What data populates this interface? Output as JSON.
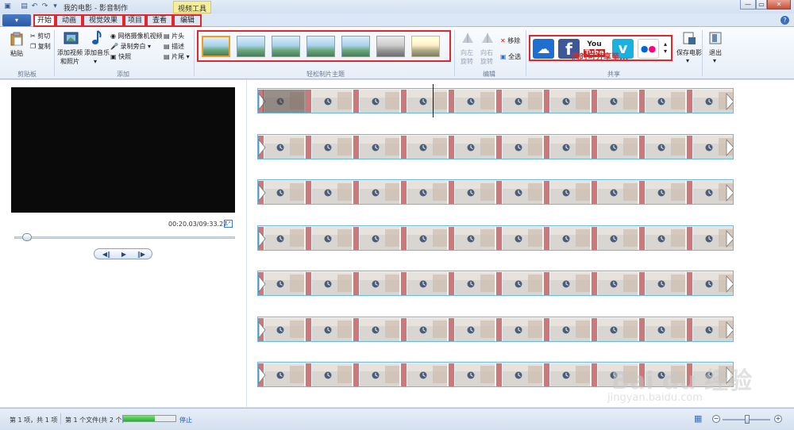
{
  "window": {
    "title": "我的电影 - 影音制作",
    "context_tab": "视频工具",
    "controls": {
      "minimize": "—",
      "maximize": "▭",
      "close": "✕"
    }
  },
  "tabs": [
    {
      "label": "开始",
      "active": true
    },
    {
      "label": "动画",
      "active": false
    },
    {
      "label": "视觉效果",
      "active": false
    },
    {
      "label": "项目",
      "active": false
    },
    {
      "label": "查看",
      "active": false
    },
    {
      "label": "编辑",
      "active": false
    }
  ],
  "file_button": "▾",
  "ribbon": {
    "clipboard": {
      "paste": "粘贴",
      "cut": "剪切",
      "copy": "复制",
      "group": "剪贴板"
    },
    "add": {
      "add_video_line1": "添加视频",
      "add_video_line2": "和照片",
      "add_music": "添加音乐",
      "webcam": "网络摄像机视频",
      "narration": "录制旁白",
      "snapshot": "快照",
      "title": "片头",
      "caption": "描述",
      "credits": "片尾",
      "group": "添加"
    },
    "themes": {
      "group": "轻松制片主题",
      "count": 7,
      "selected_index": 0
    },
    "editing": {
      "rotate_left_line1": "向左",
      "rotate_left_line2": "旋转",
      "rotate_right_line1": "向右",
      "rotate_right_line2": "旋转",
      "remove": "移除",
      "select_all": "全选",
      "group": "编辑"
    },
    "share": {
      "group": "共享",
      "note": "同时可分享至...",
      "services": [
        {
          "name": "onedrive",
          "glyph": "☁",
          "color": "#1e6fd0"
        },
        {
          "name": "facebook",
          "glyph": "f",
          "color": "#3b5998"
        },
        {
          "name": "youtube",
          "glyph": "You\nTube",
          "color": "#d62020"
        },
        {
          "name": "vimeo",
          "glyph": "v",
          "color": "#1ab0e0"
        },
        {
          "name": "flickr",
          "glyph": "●●",
          "color": "#ffffff"
        }
      ],
      "save_movie": "保存电影"
    },
    "exit": {
      "label": "退出"
    }
  },
  "preview": {
    "time": "00:20.03/09:33.27",
    "seek_fraction": 0.035
  },
  "storyboard": {
    "rows": 7,
    "frames_per_row": 10
  },
  "status": {
    "items": "第 1 项，共 1 项",
    "files": "第 1 个文件(共 2 个)",
    "progress_fraction": 0.6,
    "stop": "停止"
  },
  "watermark": {
    "logo": "Bai du 经验",
    "url": "jingyan.baidu.com"
  },
  "colors": {
    "highlight": "#e0282c",
    "accent": "#3a6fc0"
  }
}
